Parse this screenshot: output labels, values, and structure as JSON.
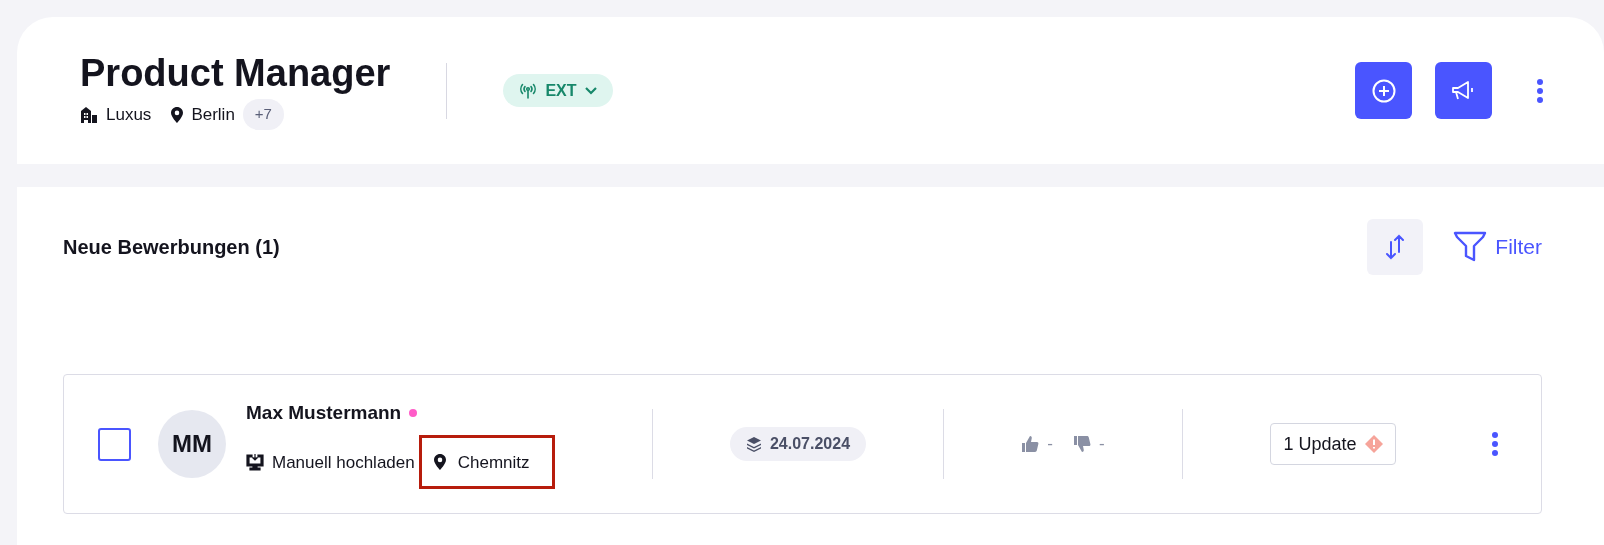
{
  "header": {
    "title": "Product Manager",
    "company": "Luxus",
    "location": "Berlin",
    "more_locations": "+7",
    "channel_badge": "EXT"
  },
  "section": {
    "title": "Neue Bewerbungen (1)",
    "filter_label": "Filter"
  },
  "applications": [
    {
      "checked": false,
      "initials": "MM",
      "name": "Max Mustermann",
      "unread": true,
      "source": "Manuell hochladen",
      "location": "Chemnitz",
      "location_highlighted": true,
      "date": "24.07.2024",
      "likes": "-",
      "dislikes": "-",
      "updates": "1 Update",
      "update_warning": true
    }
  ]
}
